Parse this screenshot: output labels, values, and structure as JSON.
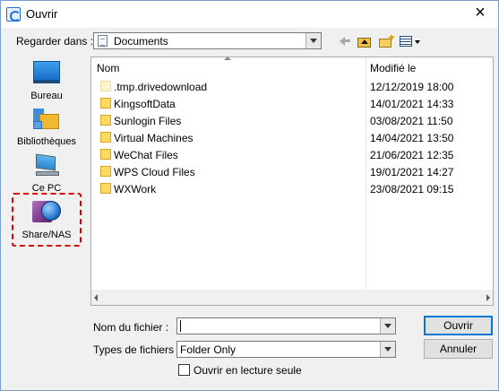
{
  "window": {
    "title": "Ouvrir",
    "close_label": "×"
  },
  "lookin": {
    "label": "Regarder dans :",
    "value": "Documents"
  },
  "toolbar": {
    "back_icon": "back-arrow-icon",
    "up_icon": "up-one-level-icon",
    "new_folder_icon": "new-folder-icon",
    "view_menu_icon": "view-menu-icon"
  },
  "places": [
    {
      "label": "Bureau",
      "icon": "desktop-icon"
    },
    {
      "label": "Bibliothèques",
      "icon": "libraries-icon"
    },
    {
      "label": "Ce PC",
      "icon": "computer-icon"
    },
    {
      "label": "Share/NAS",
      "icon": "network-share-icon",
      "highlighted": true
    }
  ],
  "columns": {
    "name": "Nom",
    "modified": "Modifié le"
  },
  "files": [
    {
      "name": ".tmp.drivedownload",
      "modified": "12/12/2019 18:00",
      "hidden": true
    },
    {
      "name": "KingsoftData",
      "modified": "14/01/2021 14:33"
    },
    {
      "name": "Sunlogin Files",
      "modified": "03/08/2021 11:50"
    },
    {
      "name": "Virtual Machines",
      "modified": "14/04/2021 13:50"
    },
    {
      "name": "WeChat Files",
      "modified": "21/06/2021 12:35"
    },
    {
      "name": "WPS Cloud Files",
      "modified": "19/01/2021 14:27"
    },
    {
      "name": "WXWork",
      "modified": "23/08/2021 09:15"
    }
  ],
  "filename": {
    "label": "Nom du fichier :",
    "value": ""
  },
  "filetype": {
    "label": "Types de fichiers :",
    "value": "Folder Only"
  },
  "buttons": {
    "open": "Ouvrir",
    "cancel": "Annuler"
  },
  "readonly": {
    "label": "Ouvrir en lecture seule",
    "checked": false
  },
  "colors": {
    "highlight": "#e00000",
    "accent": "#0078d7",
    "folder": "#ffd966"
  }
}
